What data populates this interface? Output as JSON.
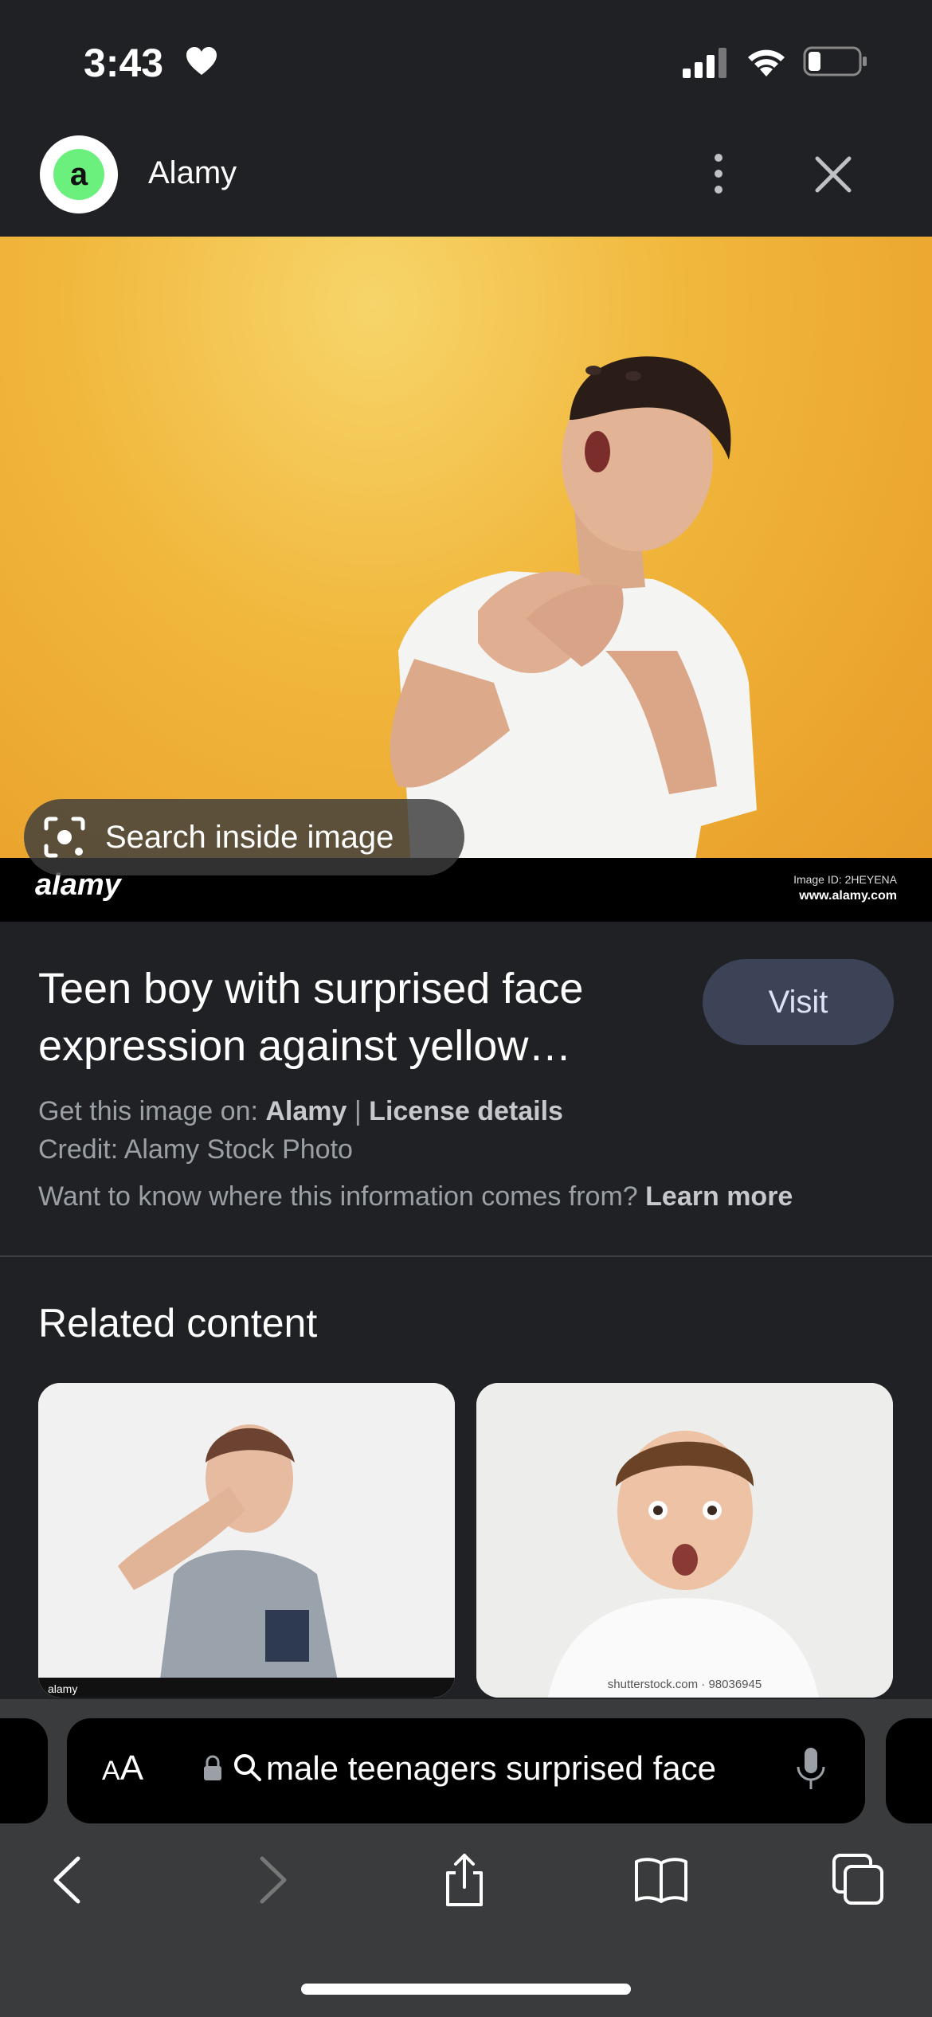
{
  "status_bar": {
    "time": "3:43",
    "icons": [
      "heart-icon",
      "signal-icon",
      "wifi-icon",
      "battery-icon"
    ]
  },
  "header": {
    "site_logo_letter": "a",
    "site_name": "Alamy",
    "menu_icon": "more-vert-icon",
    "close_icon": "close-icon"
  },
  "image": {
    "watermark_logo": "alamy",
    "image_id": "Image ID: 2HEYENA",
    "image_url": "www.alamy.com",
    "search_inside_label": "Search inside image"
  },
  "info": {
    "title": "Teen boy with surprised face expression against yellow…",
    "visit_label": "Visit",
    "source_prefix": "Get this image on: ",
    "source_name": "Alamy",
    "separator": " | ",
    "license_label": "License details",
    "credit": "Credit: Alamy Stock Photo",
    "info_question": "Want to know where this information comes from? ",
    "learn_more": "Learn more"
  },
  "related": {
    "heading": "Related content",
    "items": [
      {
        "caption": "alamy"
      },
      {
        "caption": "shutterstock.com · 98036945"
      }
    ]
  },
  "browser": {
    "aa_label_small": "A",
    "aa_label_large": "A",
    "address_text": "male teenagers surprised face",
    "nav": [
      "back-icon",
      "forward-icon",
      "share-icon",
      "bookmarks-icon",
      "tabs-icon"
    ]
  },
  "colors": {
    "background": "#202124",
    "visit_button": "#3c4356",
    "logo_green": "#6cf07d",
    "hero_yellow": "#f1b73c"
  }
}
